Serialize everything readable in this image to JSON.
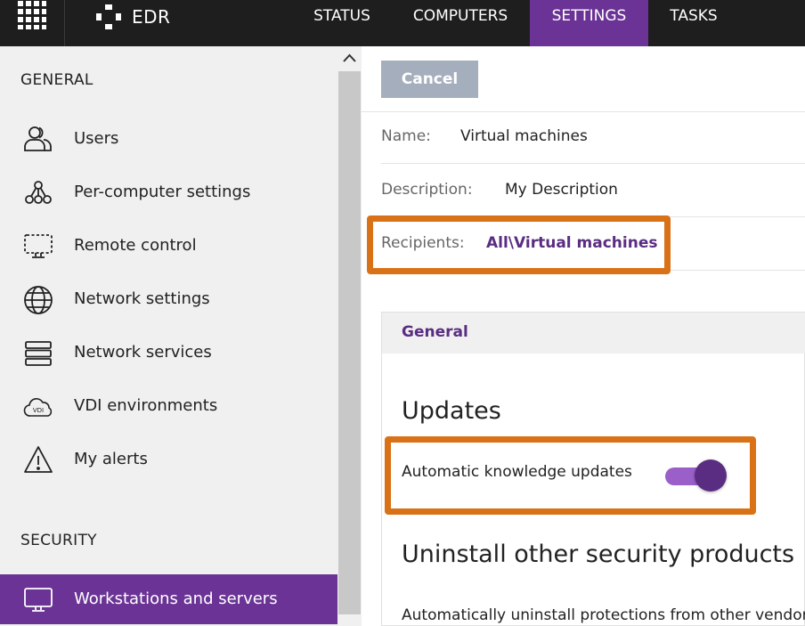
{
  "header": {
    "brand": "EDR",
    "tabs": [
      {
        "label": "STATUS",
        "active": false
      },
      {
        "label": "COMPUTERS",
        "active": false
      },
      {
        "label": "SETTINGS",
        "active": true
      },
      {
        "label": "TASKS",
        "active": false
      }
    ]
  },
  "sidebar": {
    "general_heading": "GENERAL",
    "general_items": [
      {
        "label": "Users",
        "icon": "users-icon"
      },
      {
        "label": "Per-computer settings",
        "icon": "network-nodes-icon"
      },
      {
        "label": "Remote control",
        "icon": "remote-screen-icon"
      },
      {
        "label": "Network settings",
        "icon": "globe-icon"
      },
      {
        "label": "Network services",
        "icon": "server-stack-icon"
      },
      {
        "label": "VDI environments",
        "icon": "vdi-cloud-icon"
      },
      {
        "label": "My alerts",
        "icon": "warning-icon"
      }
    ],
    "security_heading": "SECURITY",
    "security_items": [
      {
        "label": "Workstations and servers",
        "icon": "monitor-icon",
        "active": true
      }
    ]
  },
  "toolbar": {
    "cancel_label": "Cancel"
  },
  "form": {
    "name_label": "Name:",
    "name_value": "Virtual machines",
    "description_label": "Description:",
    "description_value": "My Description",
    "recipients_label": "Recipients:",
    "recipients_value": "All\\Virtual machines"
  },
  "card": {
    "tab_title": "General",
    "updates_title": "Updates",
    "auto_updates_label": "Automatic knowledge updates",
    "auto_updates_enabled": true,
    "uninstall_title": "Uninstall other security products",
    "uninstall_text": "Automatically uninstall protections from other vendors"
  },
  "colors": {
    "accent": "#6a3395",
    "highlight": "#d97117",
    "link": "#5a2d82"
  }
}
